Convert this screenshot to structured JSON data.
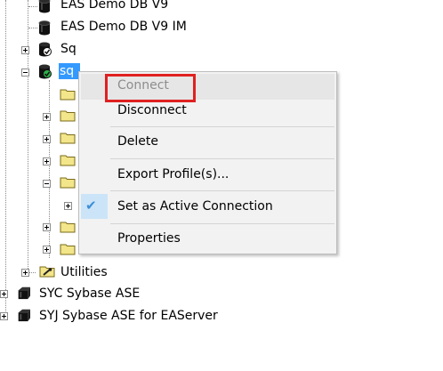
{
  "tree": {
    "items": [
      {
        "label": "EAS Demo DB V9",
        "icon": "database-icon"
      },
      {
        "label": "EAS Demo DB V9 IM",
        "icon": "database-icon"
      },
      {
        "label": "Sq",
        "icon": "database-connected-icon"
      },
      {
        "label": "sq",
        "icon": "database-active-icon"
      },
      {
        "label": "Utilities",
        "icon": "utilities-folder-icon"
      },
      {
        "label": "SYC Sybase ASE",
        "icon": "server-icon"
      },
      {
        "label": "SYJ Sybase ASE for EAServer",
        "icon": "server-icon"
      }
    ]
  },
  "context_menu": {
    "items": [
      {
        "label": "Connect",
        "enabled": false
      },
      {
        "label": "Disconnect",
        "enabled": true
      },
      {
        "label": "Delete",
        "enabled": true
      },
      {
        "label": "Export Profile(s)...",
        "enabled": true
      },
      {
        "label": "Set as Active Connection",
        "enabled": true,
        "checked": true
      },
      {
        "label": "Properties",
        "enabled": true
      }
    ],
    "check_glyph": "✔"
  },
  "colors": {
    "selection": "#3399ff",
    "annotation": "#e02020",
    "check": "#3a8fd8",
    "folder": "#f3e58a"
  }
}
